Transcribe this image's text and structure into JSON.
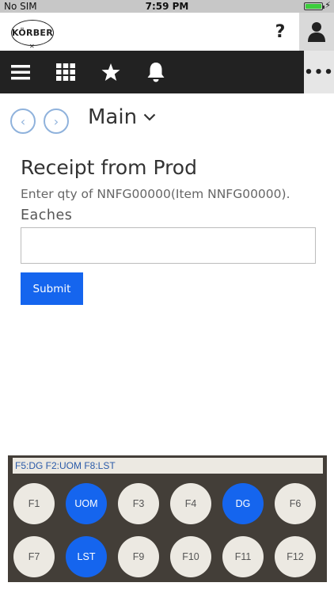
{
  "status_bar": {
    "carrier": "No SIM",
    "time": "7:59 PM",
    "battery_level": 1.0
  },
  "brand": {
    "logo_text": "KÖRBER",
    "help_label": "?"
  },
  "toolbar": {
    "items": [
      {
        "icon": "menu-icon"
      },
      {
        "icon": "grid-icon"
      },
      {
        "icon": "star-icon"
      },
      {
        "icon": "bell-icon"
      }
    ],
    "more_label": "•••"
  },
  "nav": {
    "back_icon": "‹",
    "forward_icon": "›",
    "breadcrumb": "Main",
    "dropdown_icon": "chevron-down-icon"
  },
  "form": {
    "title": "Receipt from Prod",
    "instruction": "Enter qty of NNFG00000(Item NNFG00000).",
    "field_label": "Eaches",
    "field_value": "",
    "submit_label": "Submit"
  },
  "function_keys": {
    "hint": "F5:DG  F2:UOM  F8:LST",
    "keys": [
      {
        "label": "F1",
        "active": false
      },
      {
        "label": "UOM",
        "active": true
      },
      {
        "label": "F3",
        "active": false
      },
      {
        "label": "F4",
        "active": false
      },
      {
        "label": "DG",
        "active": true
      },
      {
        "label": "F6",
        "active": false
      },
      {
        "label": "F7",
        "active": false
      },
      {
        "label": "LST",
        "active": true
      },
      {
        "label": "F9",
        "active": false
      },
      {
        "label": "F10",
        "active": false
      },
      {
        "label": "F11",
        "active": false
      },
      {
        "label": "F12",
        "active": false
      }
    ]
  },
  "colors": {
    "accent": "#1565ee",
    "toolbar_bg": "#222222",
    "panel_bg": "#433e38",
    "key_bg": "#ece9e2"
  }
}
